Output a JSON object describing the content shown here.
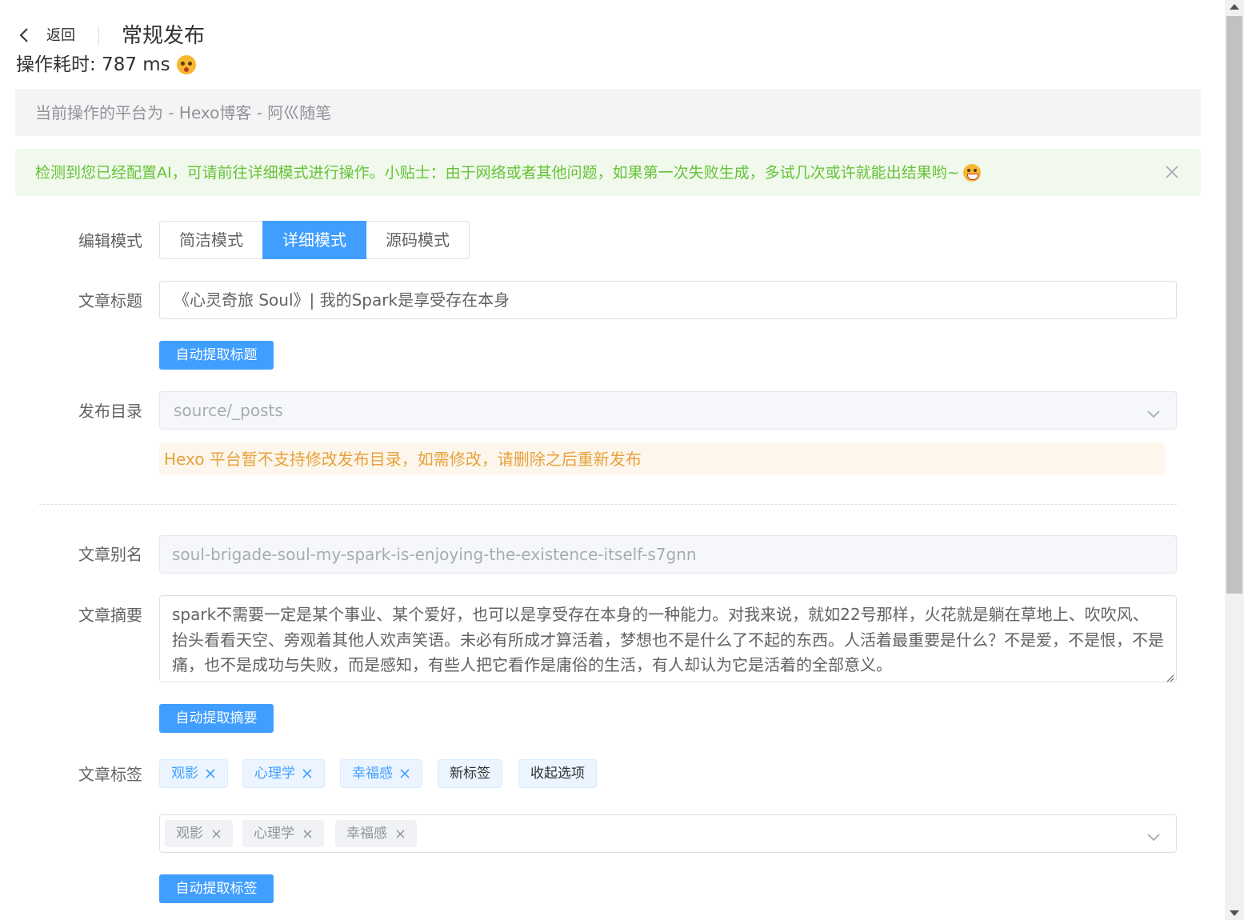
{
  "header": {
    "back_label": "返回",
    "title": "常规发布",
    "timing_label": "操作耗时: 787 ms"
  },
  "platform_info": "当前操作的平台为 - Hexo博客 - 阿巛随笔",
  "ai_alert": "检测到您已经配置AI，可请前往详细模式进行操作。小贴士：由于网络或者其他问题，如果第一次失败生成，多试几次或许就能出结果哟~",
  "form": {
    "edit_mode": {
      "label": "编辑模式",
      "options": [
        "简洁模式",
        "详细模式",
        "源码模式"
      ],
      "selected": "详细模式"
    },
    "title": {
      "label": "文章标题",
      "value": "《心灵奇旅  Soul》| 我的Spark是享受存在本身",
      "auto_button": "自动提取标题"
    },
    "directory": {
      "label": "发布目录",
      "value": "source/_posts",
      "warning": "Hexo 平台暂不支持修改发布目录，如需修改，请删除之后重新发布"
    },
    "slug": {
      "label": "文章别名",
      "value": "soul-brigade-soul-my-spark-is-enjoying-the-existence-itself-s7gnn"
    },
    "summary": {
      "label": "文章摘要",
      "value": "spark不需要一定是某个事业、某个爱好，也可以是享受存在本身的一种能力。对我来说，就如22号那样，火花就是躺在草地上、吹吹风、抬头看看天空、旁观着其他人欢声笑语。未必有所成才算活着，梦想也不是什么了不起的东西。人活着最重要是什么？不是爱，不是恨，不是痛，也不是成功与失败，而是感知，有些人把它看作是庸俗的生活，有人却认为它是活着的全部意义。",
      "auto_button": "自动提取摘要"
    },
    "tags": {
      "label": "文章标签",
      "items": [
        "观影",
        "心理学",
        "幸福感"
      ],
      "new_tag_button": "新标签",
      "collapse_button": "收起选项",
      "selected": [
        "观影",
        "心理学",
        "幸福感"
      ],
      "auto_button": "自动提取标签"
    }
  },
  "colors": {
    "primary": "#409eff",
    "success": "#67c23a",
    "warning": "#e6a23c",
    "info_bg": "#f4f4f5"
  }
}
